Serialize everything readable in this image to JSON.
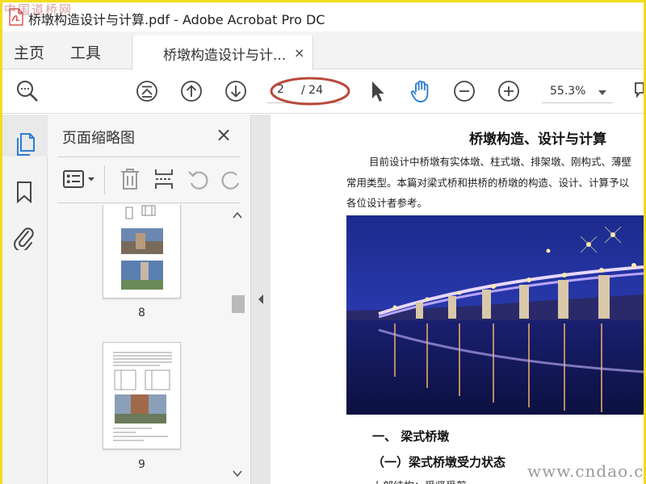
{
  "window": {
    "title": "桥墩构造设计与计算.pdf - Adobe Acrobat Pro DC",
    "watermark_top": "中国道桥网"
  },
  "nav": {
    "home": "主页",
    "tools": "工具",
    "doc_tab": "桥墩构造设计与计...",
    "doc_tab_close": "×"
  },
  "toolbar": {
    "page_current": "2",
    "page_total": "/ 24",
    "zoom": "55.3%",
    "icons": [
      "search-icon",
      "first-page-icon",
      "previous-page-icon",
      "next-page-icon",
      "select-pointer-icon",
      "hand-tool-icon",
      "zoom-out-icon",
      "zoom-in-icon",
      "comment-icon"
    ]
  },
  "rail": {
    "icons": [
      "page-thumbnails-icon",
      "bookmark-icon",
      "attachment-icon"
    ]
  },
  "panel": {
    "title": "页面缩略图",
    "close": "×",
    "tools": [
      "thumbnail-options-icon",
      "delete-icon",
      "insert-page-icon",
      "rotate-left-icon",
      "rotate-right-icon"
    ],
    "thumbnails": [
      {
        "page": "8"
      },
      {
        "page": "9"
      }
    ]
  },
  "document": {
    "title": "桥墩构造、设计与计算",
    "paragraph_lines": [
      "目前设计中桥墩有实体墩、柱式墩、排架墩、刚构式、薄壁",
      "常用类型。本篇对梁式桥和拱桥的桥墩的构造、设计、计算予以",
      "各位设计者参考。"
    ],
    "heading_1": "一、 梁式桥墩",
    "heading_2": "（一）梁式桥墩受力状态",
    "partial_line": "上部结构：受竖受剪",
    "watermark": "www.cndao.com"
  },
  "colors": {
    "accent_blue": "#2d7fd3",
    "annotation_red": "#b84a3a",
    "border_yellow": "#f2dc1e"
  }
}
